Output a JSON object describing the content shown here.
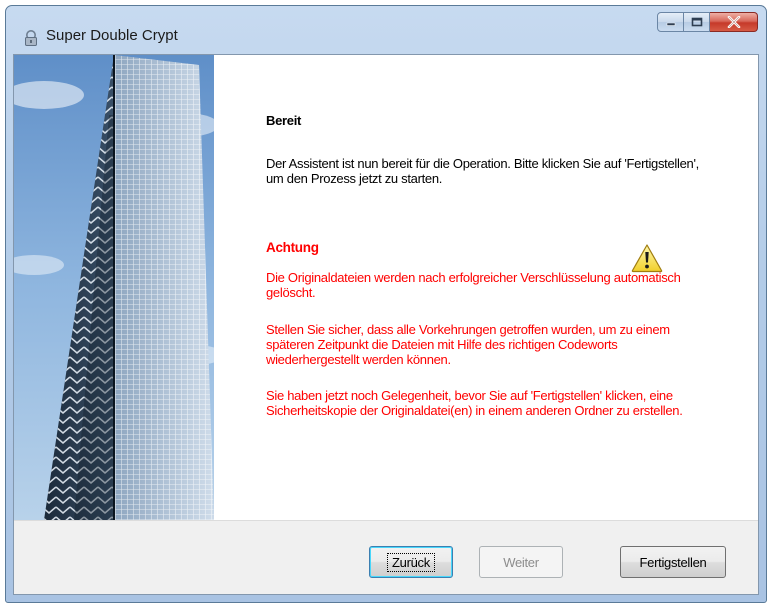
{
  "window": {
    "title": "Super Double Crypt",
    "controls": {
      "minimize_icon": "minimize-icon",
      "maximize_icon": "maximize-icon",
      "close_icon": "close-icon"
    }
  },
  "content": {
    "heading": "Bereit",
    "intro": "Der Assistent ist nun bereit für die Operation. Bitte klicken Sie auf 'Fertigstellen', um den Prozess jetzt zu starten.",
    "warning": {
      "title": "Achtung",
      "paragraphs": [
        "Die Originaldateien werden nach erfolgreicher Verschlüsselung automatisch gelöscht.",
        "Stellen Sie sicher, dass alle Vorkehrungen getroffen wurden, um zu einem späteren Zeitpunkt die Dateien mit Hilfe des richtigen Codeworts wiederhergestellt werden können.",
        "Sie haben jetzt noch Gelegenheit, bevor Sie auf 'Fertigstellen' klicken, eine Sicherheitskopie der Originaldatei(en) in einem anderen Ordner zu erstellen."
      ],
      "icon": "warning-icon"
    }
  },
  "footer": {
    "back_label": "Zurück",
    "next_label": "Weiter",
    "finish_label": "Fertigstellen"
  },
  "colors": {
    "warning_text": "#ff0000",
    "title_bar": "#b3cce8",
    "footer_bg": "#f0f0f0"
  }
}
